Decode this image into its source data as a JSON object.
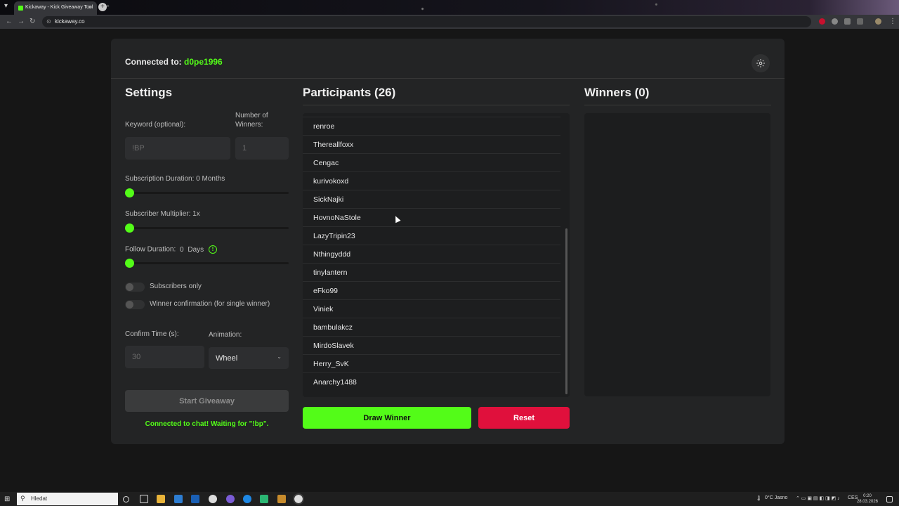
{
  "browser": {
    "tab_title": "Kickaway - Kick Giveaway Tool",
    "url": "kickaway.co"
  },
  "header": {
    "connected_label": "Connected to:",
    "username": "d0pe1996"
  },
  "settings": {
    "title": "Settings",
    "keyword_label": "Keyword (optional):",
    "keyword_placeholder": "!BP",
    "winners_label_1": "Number of",
    "winners_label_2": "Winners:",
    "winners_placeholder": "1",
    "sub_duration_label": "Subscription Duration: 0 Months",
    "sub_duration_value": 0,
    "sub_multiplier_label": "Subscriber Multiplier: 1x",
    "sub_multiplier_value": 1,
    "follow_duration_label": "Follow Duration:",
    "follow_duration_num": "0",
    "follow_duration_unit": "Days",
    "follow_info": "!",
    "subscribers_only_label": "Subscribers only",
    "subscribers_only_on": false,
    "winner_confirmation_label": "Winner confirmation (for single winner)",
    "winner_confirmation_on": false,
    "confirm_time_label": "Confirm Time (s):",
    "confirm_time_placeholder": "30",
    "animation_label": "Animation:",
    "animation_value": "Wheel",
    "start_button": "Start Giveaway",
    "status_text": "Connected to chat! Waiting for \"!bp\"."
  },
  "participants": {
    "title": "Participants (26)",
    "items": [
      "renroe",
      "Thereallfoxx",
      "Cengac",
      "kurivokoxd",
      "SickNajki",
      "HovnoNaStole",
      "LazyTripin23",
      "Nthingyddd",
      "tinylantern",
      "eFko99",
      "Viniek",
      "bambulakcz",
      "MirdoSlavek",
      "Herry_SvK",
      "Anarchy1488"
    ],
    "draw_button": "Draw Winner",
    "reset_button": "Reset"
  },
  "winners": {
    "title": "Winners (0)"
  },
  "taskbar": {
    "search_placeholder": "Hledat",
    "weather": "0°C  Jasno",
    "lang": "CES",
    "time": "0:20",
    "date": "28.03.2026"
  },
  "colors": {
    "accent": "#53fc18",
    "reset": "#e0103c",
    "card": "#232425",
    "background": "#161616"
  },
  "icons": [
    "search-icon",
    "settings-gear-icon",
    "chevron-down-icon",
    "info-icon",
    "windows-start-icon"
  ]
}
